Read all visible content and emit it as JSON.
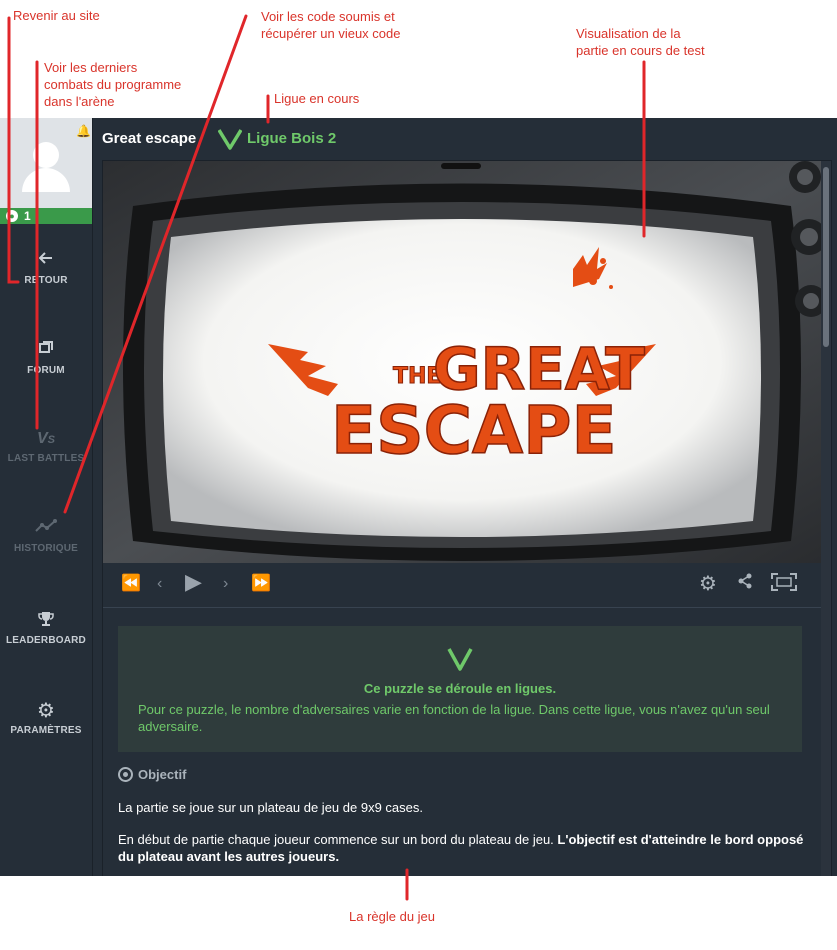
{
  "annotations": {
    "back_to_site": "Revenir au site",
    "last_battles": [
      "Voir les derniers",
      "combats du programme",
      "dans l'arène"
    ],
    "history": [
      "Voir les code soumis et",
      "récupérer un vieux code"
    ],
    "league": "Ligue en cours",
    "viewer": [
      "Visualisation de la",
      "partie en cours de test"
    ],
    "rules": "La règle du jeu"
  },
  "sidebar": {
    "level": "1",
    "items": [
      {
        "name": "retour",
        "label": "RETOUR",
        "icon": "arrow-left-icon"
      },
      {
        "name": "forum",
        "label": "FORUM",
        "icon": "forum-icon"
      },
      {
        "name": "last-battles",
        "label": "LAST BATTLES",
        "icon": "versus-icon"
      },
      {
        "name": "historique",
        "label": "HISTORIQUE",
        "icon": "history-chart-icon"
      },
      {
        "name": "leaderboard",
        "label": "LEADERBOARD",
        "icon": "trophy-icon"
      },
      {
        "name": "parametres",
        "label": "PARAMÈTRES",
        "icon": "gear-icon"
      }
    ]
  },
  "header": {
    "title": "Great escape",
    "league": "Ligue Bois 2"
  },
  "viewer": {
    "logo_line1": "THE",
    "logo_line2": "GREAT",
    "logo_line3": "ESCAPE"
  },
  "league_info": {
    "title": "Ce puzzle se déroule en ligues.",
    "text": "Pour ce puzzle, le nombre d'adversaires varie en fonction de la ligue. Dans cette ligue, vous n'avez qu'un seul adversaire."
  },
  "rules": {
    "section_title": "Objectif",
    "p1": "La partie se joue sur un plateau de jeu de 9x9 cases.",
    "p2_normal": "En début de partie chaque joueur commence sur un bord du plateau de jeu. ",
    "p2_bold": "L'objectif est d'atteindre le bord opposé du plateau avant les autres joueurs."
  },
  "colors": {
    "accent_green": "#6fc96a",
    "annotation_red": "#d9342b",
    "logo_orange": "#e44d14",
    "background": "#252e38"
  }
}
